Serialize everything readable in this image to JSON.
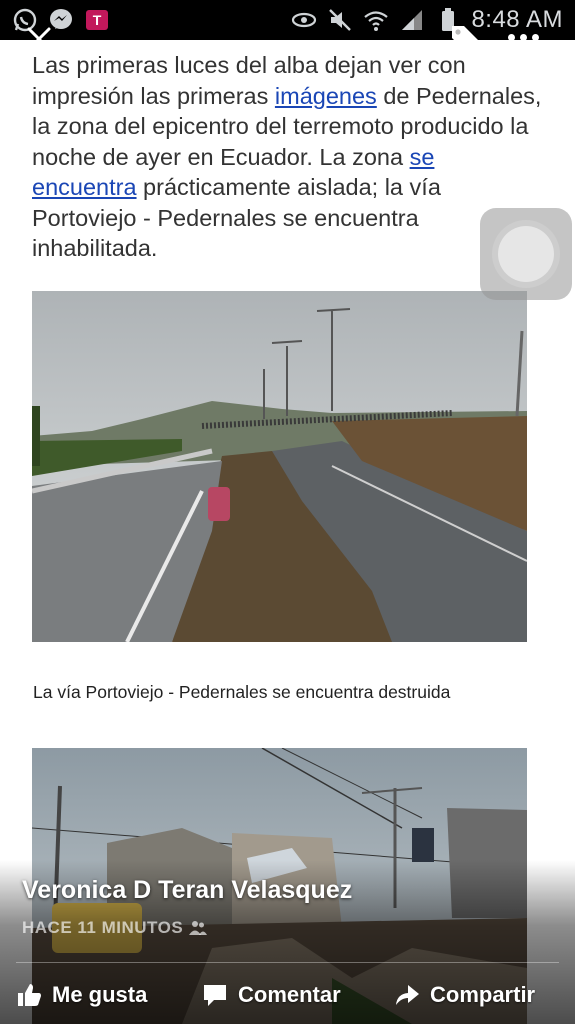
{
  "status_bar": {
    "time": "8:48 AM",
    "left_icons": [
      "whatsapp-icon",
      "messenger-icon",
      "t-mobile-icon"
    ],
    "right_icons": [
      "eye-icon",
      "mute-icon",
      "wifi-icon",
      "signal-icon",
      "battery-icon"
    ]
  },
  "article": {
    "segments": [
      {
        "text": "Las primeras luces del alba dejan ver con impresión las primeras ",
        "link": false
      },
      {
        "text": "imágenes",
        "link": true
      },
      {
        "text": " de Pedernales, la zona del epicentro del terremoto producido la noche de ayer en Ecuador. La zona ",
        "link": false
      },
      {
        "text": "se encuentra",
        "link": true
      },
      {
        "text": " prácticamente aislada; la vía Portoviejo - Pedernales se encuentra inhabilitada.",
        "link": false
      }
    ],
    "caption": "La vía Portoviejo - Pedernales se encuentra destruida"
  },
  "post": {
    "author": "Veronica D Teran Velasquez",
    "timestamp": "HACE 11 MINUTOS",
    "actions": {
      "like": "Me gusta",
      "comment": "Comentar",
      "share": "Compartir"
    }
  }
}
